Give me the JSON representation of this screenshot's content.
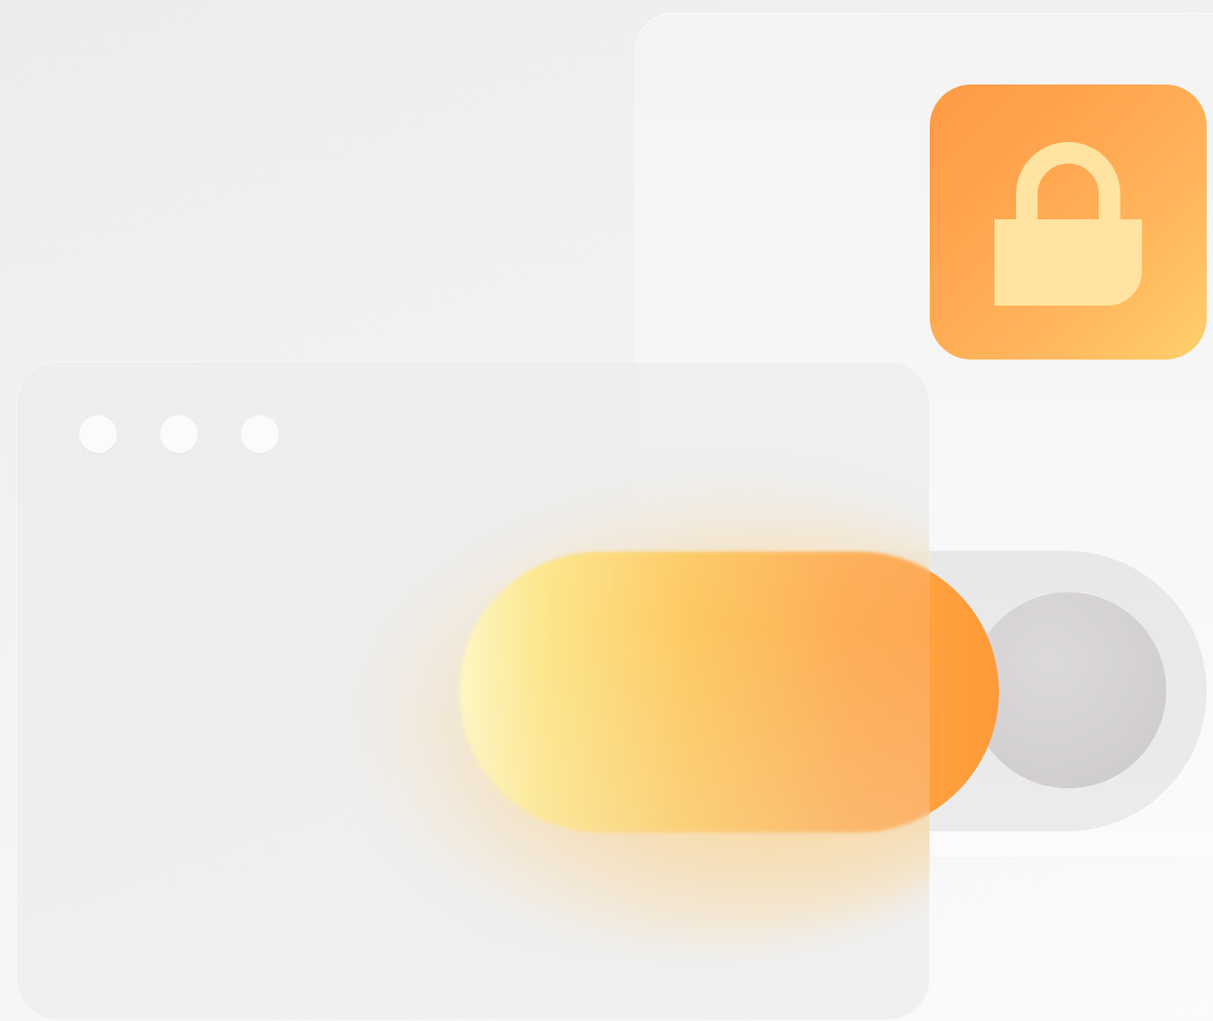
{
  "illustration": {
    "lock_tile": {
      "icon": "lock-icon",
      "color_start": "#ff9a45",
      "color_end": "#ffd06a",
      "icon_color": "#ffe3a0"
    },
    "toggle": {
      "state": "on",
      "track_color": "#e9e8e8",
      "knob_color": "#d3d0d1",
      "active_color_start": "#fff7b3",
      "active_color_end": "#ff9a3a"
    },
    "window": {
      "control_dots": [
        "dot-1",
        "dot-2",
        "dot-3"
      ],
      "dot_color": "#fbfbfb"
    }
  }
}
